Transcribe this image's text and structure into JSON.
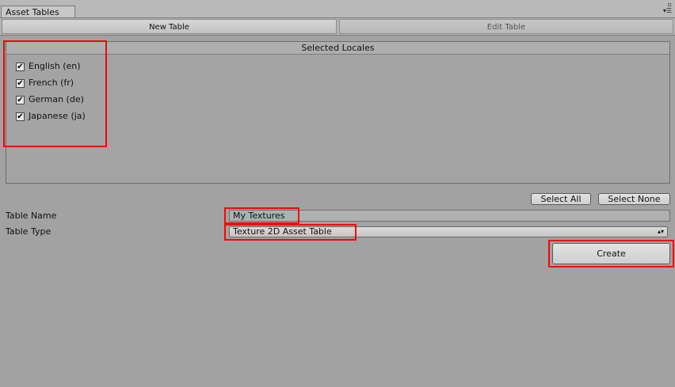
{
  "window": {
    "title": "Asset Tables",
    "icons": [
      "maximize-icon",
      "menu-icon"
    ]
  },
  "toolbar": {
    "tabs": [
      {
        "label": "New Table",
        "selected": true
      },
      {
        "label": "Edit Table",
        "selected": false
      }
    ]
  },
  "locales_panel": {
    "header": "Selected Locales",
    "items": [
      {
        "label": "English (en)",
        "checked": true
      },
      {
        "label": "French (fr)",
        "checked": true
      },
      {
        "label": "German (de)",
        "checked": true
      },
      {
        "label": "Japanese (ja)",
        "checked": true
      }
    ]
  },
  "selection_buttons": {
    "select_all": "Select All",
    "select_none": "Select None"
  },
  "form": {
    "table_name_label": "Table Name",
    "table_name_value": "My Textures",
    "table_type_label": "Table Type",
    "table_type_value": "Texture 2D Asset Table"
  },
  "create_button": "Create",
  "colors": {
    "background": "#a2a2a2",
    "highlight": "#ff0000"
  }
}
